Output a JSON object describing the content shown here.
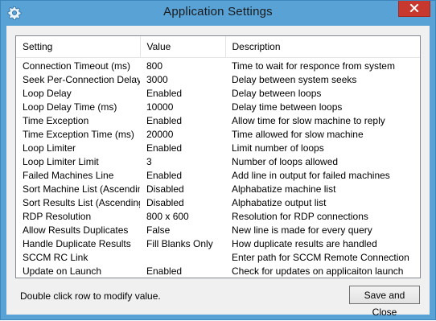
{
  "window": {
    "title": "Application Settings",
    "icon": "gear-icon",
    "close_icon": "close-icon"
  },
  "table": {
    "columns": [
      "Setting",
      "Value",
      "Description"
    ],
    "rows": [
      {
        "setting": "Connection Timeout (ms)",
        "value": "800",
        "description": "Time to wait for responce from system"
      },
      {
        "setting": "Seek Per-Connection Delay",
        "value": "3000",
        "description": "Delay between system seeks"
      },
      {
        "setting": "Loop Delay",
        "value": "Enabled",
        "description": "Delay between loops"
      },
      {
        "setting": "Loop Delay Time (ms)",
        "value": "10000",
        "description": "Delay time between loops"
      },
      {
        "setting": "Time Exception",
        "value": "Enabled",
        "description": "Allow time for slow machine to reply"
      },
      {
        "setting": "Time Exception Time (ms)",
        "value": "20000",
        "description": "Time allowed for slow machine"
      },
      {
        "setting": "Loop Limiter",
        "value": "Enabled",
        "description": "Limit number of loops"
      },
      {
        "setting": "Loop Limiter Limit",
        "value": "3",
        "description": "Number of loops allowed"
      },
      {
        "setting": "Failed Machines Line",
        "value": "Enabled",
        "description": "Add line in output for failed machines"
      },
      {
        "setting": "Sort Machine List (Ascending)",
        "value": "Disabled",
        "description": "Alphabatize machine list"
      },
      {
        "setting": "Sort Results List (Ascending)",
        "value": "Disabled",
        "description": "Alphabatize output list"
      },
      {
        "setting": "RDP Resolution",
        "value": "800 x 600",
        "description": "Resolution for RDP connections"
      },
      {
        "setting": "Allow Results Duplicates",
        "value": "False",
        "description": "New line is made for every query"
      },
      {
        "setting": "Handle Duplicate Results",
        "value": "Fill Blanks Only",
        "description": "How duplicate results are handled"
      },
      {
        "setting": "SCCM RC Link",
        "value": "",
        "description": "Enter path for SCCM Remote Connection"
      },
      {
        "setting": "Update on Launch",
        "value": "Enabled",
        "description": "Check for updates on applicaiton launch"
      }
    ]
  },
  "footer": {
    "hint": "Double click row to modify value.",
    "save_label": "Save and Close"
  },
  "colors": {
    "frame": "#58a2d6",
    "close": "#c7382e",
    "client": "#f0f0f0"
  }
}
